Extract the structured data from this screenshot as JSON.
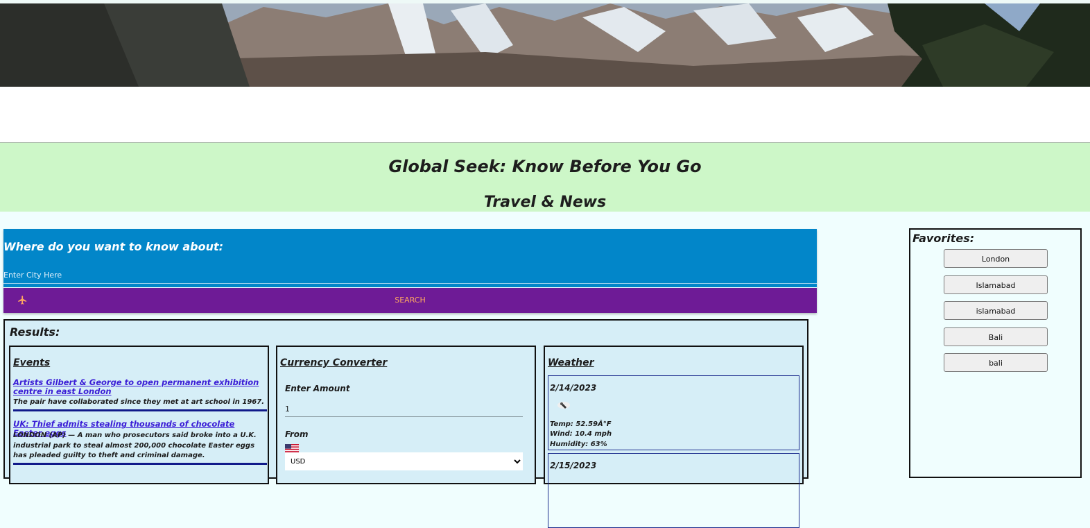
{
  "header": {
    "title": "Global Seek: Know Before You Go",
    "subtitle": "Travel & News"
  },
  "search": {
    "heading": "Where do you want to know about:",
    "placeholder": "Enter City Here",
    "button_label": "SEARCH",
    "button_icon": "airplane-icon"
  },
  "results": {
    "heading": "Results:",
    "events": {
      "title": "Events",
      "items": [
        {
          "headline": "Artists Gilbert & George to open permanent exhibition centre in east London",
          "summary": "The pair have collaborated since they met at art school in 1967."
        },
        {
          "headline": "UK: Thief admits stealing thousands of chocolate Easter eggs",
          "summary": "LONDON (AP) — A man who prosecutors said broke into a U.K. industrial park to steal almost 200,000 chocolate Easter eggs has pleaded guilty to theft and criminal damage."
        }
      ]
    },
    "currency": {
      "title": "Currency Converter",
      "amount_label": "Enter Amount",
      "amount_value": "1",
      "from_label": "From",
      "from_flag_icon": "us-flag-icon",
      "from_value": "USD"
    },
    "weather": {
      "title": "Weather",
      "days": [
        {
          "date": "2/14/2023",
          "icon": "rain-cloud-icon",
          "temp": "Temp: 52.59Â°F",
          "wind": "Wind: 10.4 mph",
          "humidity": "Humidity: 63%"
        },
        {
          "date": "2/15/2023"
        }
      ]
    }
  },
  "favorites": {
    "heading": "Favorites:",
    "items": [
      "London",
      "Islamabad",
      "islamabad",
      "Bali",
      "bali"
    ]
  },
  "colors": {
    "page_bg": "#f0fefe",
    "green_band": "#cdf7c8",
    "search_blue": "#0286c9",
    "search_button_purple": "#6e1b96",
    "search_button_text": "#ffa860",
    "results_bg": "#d6eef7",
    "link": "#3a1dd6"
  }
}
